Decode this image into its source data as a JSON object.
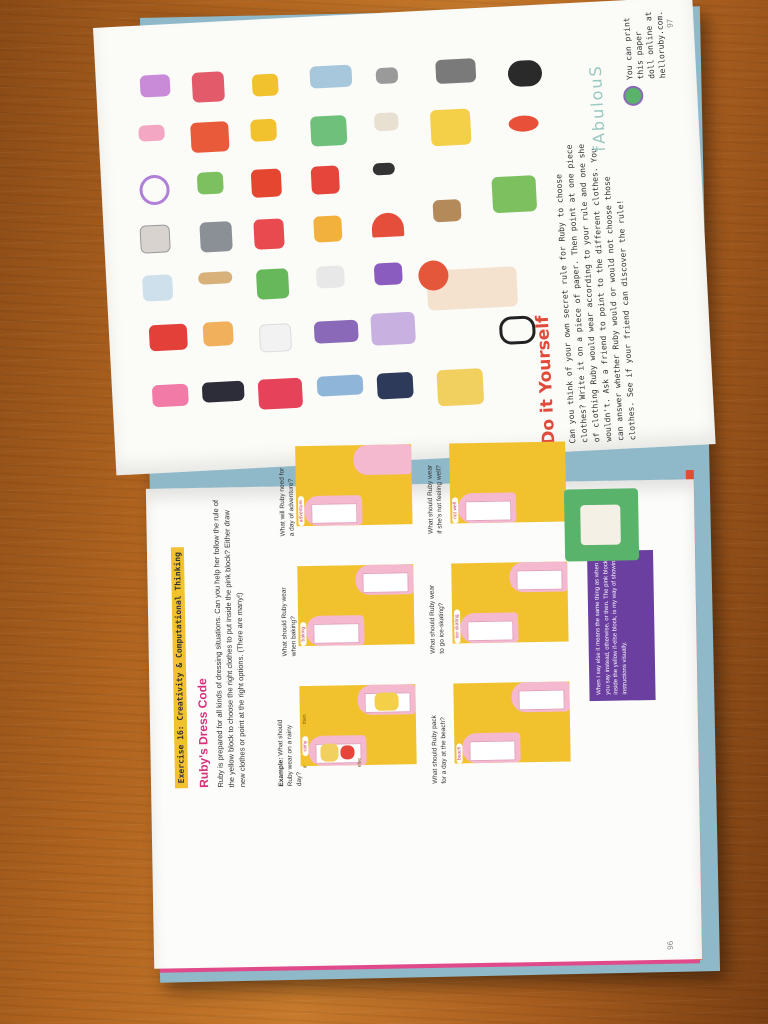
{
  "page_numbers": {
    "left": "96",
    "right": "97"
  },
  "exercise": {
    "banner": "Exercise 16: Creativity & Computational Thinking",
    "title": "Ruby's Dress Code",
    "intro": "Ruby is prepared for all kinds of dressing situations. Can you help her follow the rule of the yellow block to choose the right clothes to put inside the pink block? Either draw new clothes or point at the right options. (There are many!)",
    "example_label": "Example:",
    "example_question": "What should Ruby wear on a rainy day?",
    "questions": [
      {
        "text": "What should Ruby wear when baking?",
        "condition": "baking"
      },
      {
        "text": "What will Ruby need for a day of adventure?",
        "condition": "adventure"
      },
      {
        "text": "What should Ruby pack for a day at the beach?",
        "condition": "beach"
      },
      {
        "text": "What should Ruby wear to go ice-skating?",
        "condition": "ice-skating"
      },
      {
        "text": "What should Ruby wear if she's not feeling well?",
        "condition": "not well"
      }
    ],
    "example_condition": "rainy",
    "kw_if": "if",
    "kw_then": "then",
    "kw_else": "else",
    "callout": "When I say else it means the same thing as when you say instead, otherwise, or then. The pink block, inside the yellow if-else block, is my way of showing instructions visually."
  },
  "right_page": {
    "heading": "Do it Yourself",
    "body": "Can you think of your own secret rule for Ruby to choose clothes? Write it on a piece of paper. Then point at one piece of clothing Ruby would wear according to your rule and one she wouldn't. Ask a friend to point to the different clothes. You can answer whether Ruby would or would not choose those clothes. See if your friend can discover the rule!",
    "fabulous_word": "fAbulouS",
    "print_note": "You can print this paper doll online at helloruby.com."
  },
  "colors": {
    "yellow_block": "#f2c12e",
    "pink_block": "#f4b8cf",
    "title_pink": "#d8307a",
    "callout_purple": "#6a3fa0",
    "accent_green": "#59b36a"
  }
}
